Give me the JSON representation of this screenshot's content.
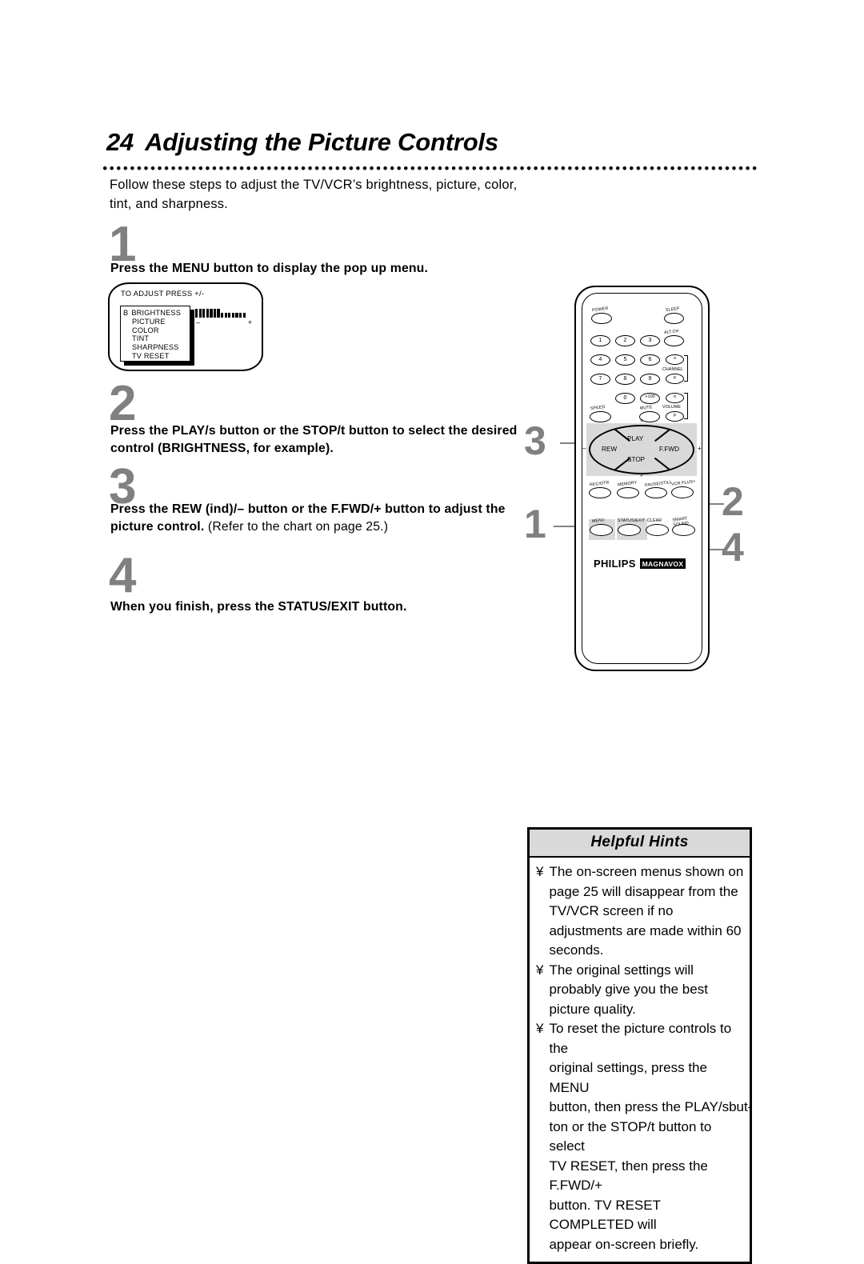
{
  "page": {
    "number": "24",
    "title": "Adjusting the Picture Controls",
    "intro": "Follow these steps to adjust the TV/VCR’s brightness, picture, color, tint, and sharpness."
  },
  "steps": [
    {
      "number": "1",
      "text_bold": "Press the MENU button to display the pop up menu.",
      "text_regular": ""
    },
    {
      "number": "2",
      "text_bold": "Press the PLAY/s  button or the STOP/t  button to select the desired control (BRIGHTNESS, for example).",
      "text_regular": ""
    },
    {
      "number": "3",
      "text_bold": "Press the REW (ind)/– button or the F.FWD/+ button to adjust the picture control.",
      "text_regular": "(Refer to the chart on page 25.)"
    },
    {
      "number": "4",
      "text_bold": "When you finish, press the STATUS/EXIT button.",
      "text_regular": ""
    }
  ],
  "osd": {
    "caption": "TO ADJUST PRESS +/-",
    "selected_prefix": "B",
    "items": [
      "BRIGHTNESS",
      "PICTURE",
      "COLOR",
      "TINT",
      "SHARPNESS",
      "TV RESET"
    ],
    "gauge": {
      "filled": 7,
      "empty": 7,
      "minus_label": "–",
      "plus_label": "+"
    }
  },
  "remote": {
    "brand_primary": "PHILIPS",
    "brand_secondary": "MAGNAVOX",
    "buttons": {
      "power": "POWER",
      "sleep": "SLEEP",
      "alt_ch": "ALT.CH",
      "speed": "SPEED",
      "mute": "MUTE",
      "channel": "CHANNEL",
      "volume": "VOLUME",
      "ch_up": "o",
      "ch_down": "p",
      "vol_up": "o",
      "vol_down": "p",
      "rec_otr": "REC/OTR",
      "memory": "MEMORY",
      "pause_still": "PAUSE/STILL",
      "vcr_plus": "VCR PLUS+",
      "menu": "MENU",
      "status_exit": "STATUS/EXIT",
      "clear": "CLEAR",
      "smart_sound": "SMART SOUND"
    },
    "keypad": [
      "1",
      "2",
      "3",
      "4",
      "5",
      "6",
      "7",
      "8",
      "9",
      "0",
      "+100"
    ],
    "nav": {
      "play": "PLAY",
      "stop": "STOP",
      "rew": "REW",
      "ffwd": "F.FWD",
      "minus": "–",
      "plus": "+",
      "up": "o",
      "down": "p"
    }
  },
  "callouts": [
    "3",
    "1",
    "2",
    "4"
  ],
  "hints": {
    "title": "Helpful Hints",
    "bullet": "¥",
    "items": [
      "The on-screen menus shown on page 25 will disappear from the TV/VCR screen if no adjustments are made within 60 seconds.",
      "The original settings will probably give you the best picture quality.",
      "To reset the picture controls to the original settings, press the MENU button, then press the PLAY/s but-ton or the STOP/t button to select TV RESET, then press the F.FWD/+ button. TV RESET COMPLETED will appear on-screen briefly."
    ],
    "item3_lines": [
      "To reset the picture controls to the",
      "original settings, press the MENU",
      "button, then press the PLAY/s",
      "but-",
      "ton or the STOP/t button to select",
      "TV RESET, then press the F.FWD/+",
      "button. TV RESET COMPLETED will",
      "appear on-screen briefly."
    ]
  },
  "colors": {
    "step_number": "#808080",
    "shade": "#d9d9d9",
    "ink": "#000000"
  }
}
